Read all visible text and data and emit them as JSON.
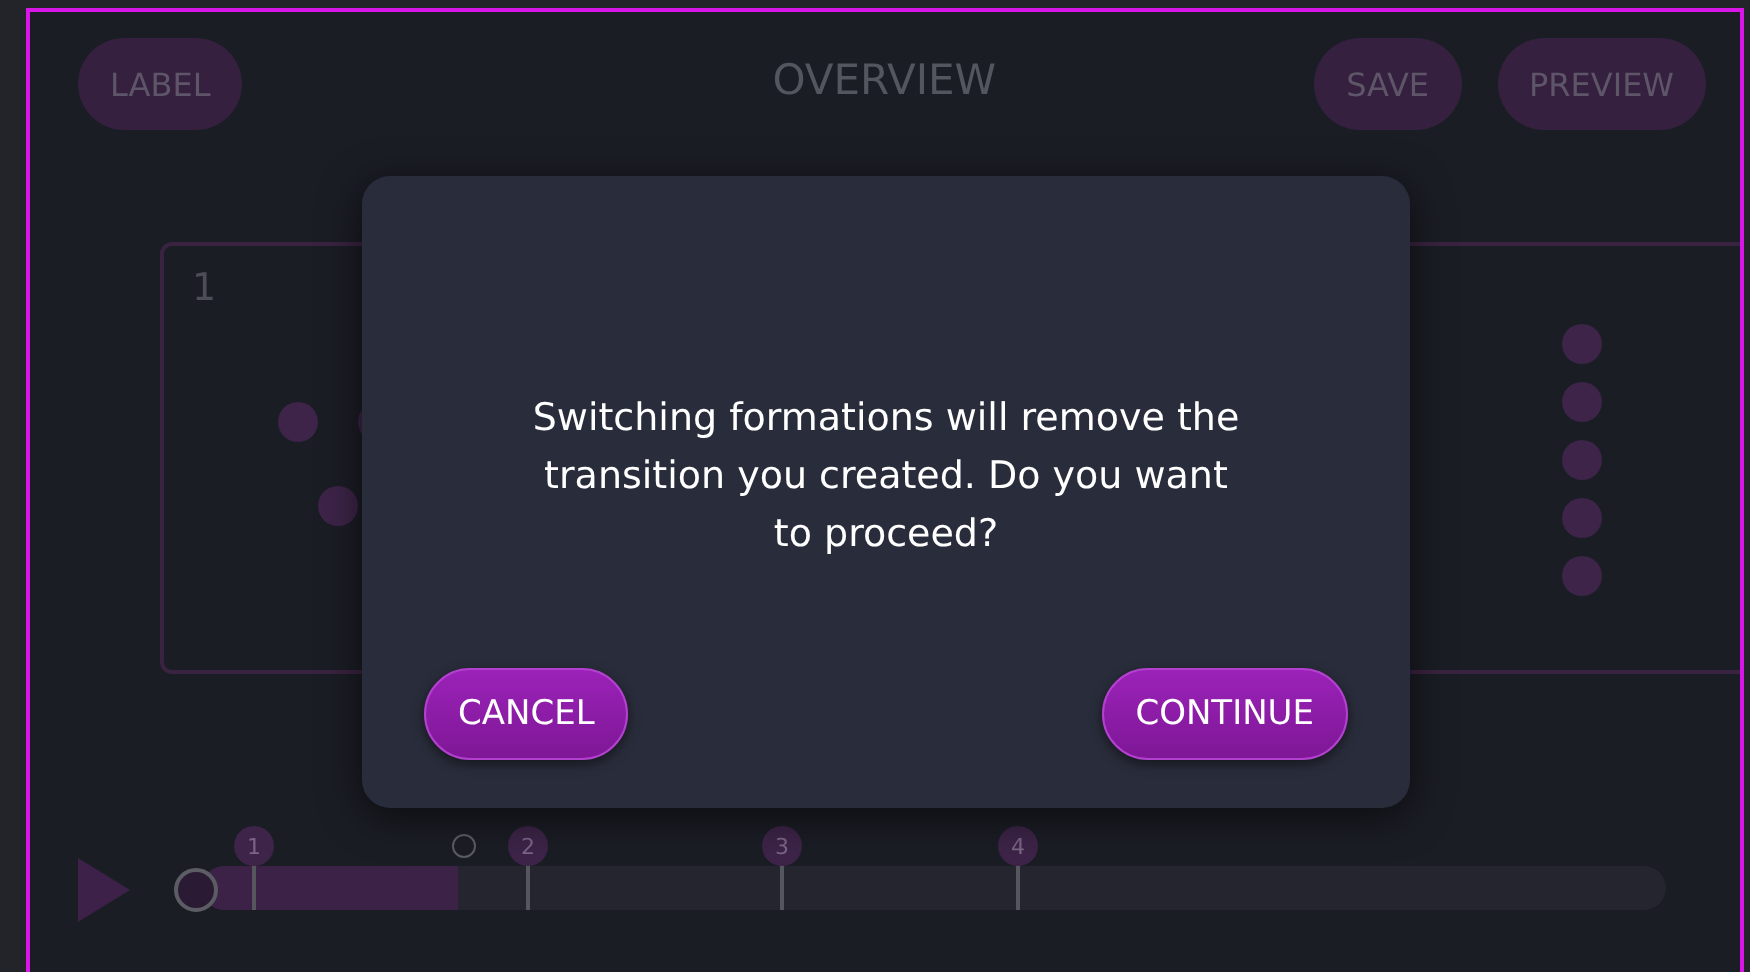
{
  "header": {
    "label_button": "LABEL",
    "title": "OVERVIEW",
    "save_button": "SAVE",
    "preview_button": "PREVIEW"
  },
  "formations": [
    {
      "kind": "scatter",
      "number": "1"
    },
    {
      "kind": "column"
    }
  ],
  "timeline": {
    "level": 0.175,
    "markers": [
      "1",
      "2",
      "3",
      "4"
    ]
  },
  "dialog": {
    "message": "Switching formations will remove the transition you created. Do you want to proceed?",
    "cancel": "CANCEL",
    "continue": "CONTINUE"
  }
}
